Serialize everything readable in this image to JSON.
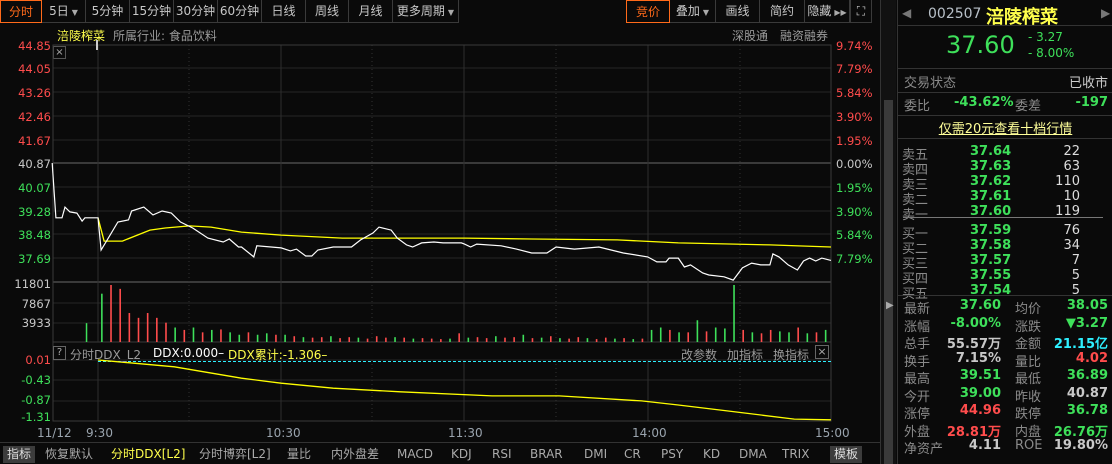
{
  "toolbar": {
    "periods": [
      {
        "label": "分时",
        "active": true
      },
      {
        "label": "5日",
        "dropdown": true
      },
      {
        "label": "5分钟"
      },
      {
        "label": "15分钟"
      },
      {
        "label": "30分钟"
      },
      {
        "label": "60分钟"
      },
      {
        "label": "日线"
      },
      {
        "label": "周线"
      },
      {
        "label": "月线"
      },
      {
        "label": "更多周期",
        "dropdown": true
      }
    ],
    "right": [
      {
        "label": "竞价",
        "active": true
      },
      {
        "label": "叠加"
      },
      {
        "label": "画线"
      },
      {
        "label": "简约"
      },
      {
        "label": "隐藏"
      }
    ]
  },
  "chart_header": {
    "name": "涪陵榨菜",
    "industry": "所属行业: 食品饮料",
    "tag1": "深股通",
    "tag2": "融资融券"
  },
  "colors": {
    "up": "#ff4c4c",
    "down": "#3ee05a",
    "price_line": "#ffffff",
    "avg_line": "#ffff00",
    "ddx_line": "#2ef0ff"
  },
  "chart_data": [
    {
      "type": "line",
      "title": "分时",
      "prev_close": 40.87,
      "y_ticks": [
        "44.85",
        "44.05",
        "43.26",
        "42.46",
        "41.67",
        "40.87",
        "40.07",
        "39.28",
        "38.48",
        "37.69"
      ],
      "pct_ticks": [
        "9.74%",
        "7.79%",
        "5.84%",
        "3.90%",
        "1.95%",
        "0.00%",
        "1.95%",
        "3.90%",
        "5.84%",
        "7.79%"
      ],
      "x_ticks": [
        "11/12",
        "9:30",
        "10:30",
        "11:30",
        "14:00",
        "15:00"
      ],
      "price_series": {
        "name": "价格",
        "minutes": [
          -15,
          -14.4,
          -13.8,
          -11.8,
          -10.8,
          -9.2,
          -6.9,
          -5.2,
          -4.3,
          0,
          1,
          3,
          6.5,
          10,
          11,
          15,
          18,
          21,
          24,
          27,
          31,
          36,
          41,
          43,
          46,
          47,
          51,
          52,
          60,
          63,
          65,
          68,
          70,
          72,
          77,
          83,
          86,
          90,
          92,
          96,
          98,
          101,
          103,
          106,
          110,
          113,
          119,
          120,
          122,
          124,
          132,
          137,
          142,
          147,
          150,
          156,
          164,
          172,
          180,
          183,
          186,
          187,
          190,
          192,
          194,
          198,
          200,
          205,
          208,
          211,
          214,
          217,
          220,
          221,
          223,
          226,
          229,
          231,
          233,
          235,
          237,
          240
        ],
        "values": [
          40.87,
          39.96,
          39.03,
          39.03,
          39.39,
          39.23,
          39.19,
          38.92,
          39.03,
          39.03,
          37.95,
          38.29,
          38.89,
          38.96,
          39.26,
          39.39,
          39.13,
          39.26,
          39.19,
          38.89,
          38.69,
          38.35,
          38.22,
          38.32,
          38.05,
          38.05,
          37.72,
          38.09,
          38.02,
          37.92,
          37.98,
          37.75,
          37.75,
          37.95,
          38.05,
          38.05,
          38.29,
          38.52,
          38.72,
          38.62,
          38.35,
          38.12,
          38.05,
          38.19,
          38.22,
          38.19,
          38.19,
          38.15,
          38.05,
          38.15,
          38.09,
          37.98,
          37.85,
          37.85,
          38.05,
          37.98,
          38.05,
          37.85,
          37.72,
          37.55,
          37.55,
          37.68,
          37.68,
          37.38,
          37.45,
          37.18,
          37.11,
          37.05,
          36.94,
          37.35,
          37.51,
          37.45,
          37.45,
          37.82,
          37.72,
          37.45,
          37.28,
          37.58,
          37.68,
          37.58,
          37.68,
          37.6
        ]
      },
      "avg_series": {
        "name": "均价",
        "minutes": [
          0,
          2,
          8,
          17,
          22,
          30,
          37,
          47,
          60,
          80,
          120,
          142,
          170,
          190,
          220,
          240
        ],
        "values": [
          39.03,
          38.25,
          38.25,
          38.62,
          38.69,
          38.76,
          38.72,
          38.55,
          38.45,
          38.35,
          38.35,
          38.32,
          38.29,
          38.19,
          38.12,
          38.05
        ]
      }
    },
    {
      "type": "bar",
      "title": "成交量",
      "y_ticks": [
        "11801",
        "7867",
        "3933"
      ],
      "ylim": [
        0,
        11801
      ],
      "auction_volume": -3900,
      "interval_minutes": 3,
      "values": [
        -10000,
        11800,
        11000,
        6000,
        5000,
        6000,
        5000,
        4000,
        -3000,
        2500,
        -3000,
        2000,
        -2500,
        2600,
        -2000,
        -1500,
        2000,
        -1500,
        -1800,
        1500,
        -1500,
        1200,
        -1000,
        900,
        1000,
        -1200,
        800,
        1000,
        -900,
        700,
        1200,
        900,
        -1000,
        900,
        -700,
        800,
        700,
        600,
        -700,
        1800,
        -900,
        1000,
        800,
        -1200,
        900,
        1000,
        -1500,
        800,
        -900,
        1200,
        -800,
        700,
        1000,
        -800,
        600,
        900,
        -700,
        800,
        -600,
        700,
        -2500,
        -3000,
        2500,
        -2000,
        2000,
        -4500,
        2200,
        -3000,
        -2800,
        -11800,
        2500,
        -2000,
        1800,
        2500,
        -2200,
        -2000,
        3000,
        -1800,
        2000,
        -2500
      ]
    },
    {
      "type": "line",
      "title": "分时DDX_L2",
      "y_ticks": [
        "0.01",
        "-0.43",
        "-0.87",
        "-1.31"
      ],
      "ylim": [
        -1.31,
        0.01
      ],
      "ddx_cum": {
        "name": "DDX累计",
        "minutes": [
          0,
          25,
          47,
          60,
          77,
          99,
          129,
          151,
          178,
          190,
          206,
          228,
          240
        ],
        "values": [
          0.01,
          -0.14,
          -0.39,
          -0.5,
          -0.61,
          -0.69,
          -0.78,
          -0.78,
          -0.89,
          -0.98,
          -1.11,
          -1.29,
          -1.306
        ]
      },
      "ddx_value": 0.0
    }
  ],
  "indicator": {
    "help": "?",
    "name": "分时DDX_L2",
    "ddx": "DDX:0.000–",
    "ddx_cum": "DDX累计:-1.306–",
    "actions": [
      "改参数",
      "加指标",
      "换指标"
    ]
  },
  "bottom_tabs": [
    "指标",
    "恢复默认",
    "分时DDX[L2]",
    "分时博弈[L2]",
    "量比",
    "内外盘差",
    "MACD",
    "KDJ",
    "RSI",
    "BRAR",
    "DMI",
    "CR",
    "PSY",
    "KD",
    "DMA",
    "TRIX",
    "模板"
  ],
  "quote": {
    "code": "002507",
    "name": "涪陵榨菜",
    "price": "37.60",
    "change": "- 3.27",
    "change_pct": "- 8.00%",
    "status_label": "交易状态",
    "status": "已收市",
    "weibi_label": "委比",
    "weibi": "-43.62%",
    "weicha_label": "委差",
    "weicha": "-197",
    "promo": "仅需20元查看十档行情",
    "asks": [
      {
        "label": "卖五",
        "price": "37.64",
        "vol": "22"
      },
      {
        "label": "卖四",
        "price": "37.63",
        "vol": "63"
      },
      {
        "label": "卖三",
        "price": "37.62",
        "vol": "110"
      },
      {
        "label": "卖二",
        "price": "37.61",
        "vol": "10"
      },
      {
        "label": "卖一",
        "price": "37.60",
        "vol": "119"
      }
    ],
    "bids": [
      {
        "label": "买一",
        "price": "37.59",
        "vol": "76"
      },
      {
        "label": "买二",
        "price": "37.58",
        "vol": "34"
      },
      {
        "label": "买三",
        "price": "37.57",
        "vol": "7"
      },
      {
        "label": "买四",
        "price": "37.55",
        "vol": "5"
      },
      {
        "label": "买五",
        "price": "37.54",
        "vol": "5"
      }
    ],
    "stats": [
      {
        "l1": "最新",
        "v1": "37.60",
        "c1": "green",
        "l2": "均价",
        "v2": "38.05",
        "c2": "green"
      },
      {
        "l1": "涨幅",
        "v1": "-8.00%",
        "c1": "green",
        "l2": "涨跌",
        "v2": "▼3.27",
        "c2": "green"
      },
      {
        "l1": "总手",
        "v1": "55.57万",
        "c1": "white",
        "l2": "金额",
        "v2": "21.15亿",
        "c2": "cyan"
      },
      {
        "l1": "换手",
        "v1": "7.15%",
        "c1": "white",
        "l2": "量比",
        "v2": "4.02",
        "c2": "red"
      },
      {
        "l1": "最高",
        "v1": "39.51",
        "c1": "green",
        "l2": "最低",
        "v2": "36.89",
        "c2": "green"
      },
      {
        "l1": "今开",
        "v1": "39.00",
        "c1": "green",
        "l2": "昨收",
        "v2": "40.87",
        "c2": "white"
      },
      {
        "l1": "涨停",
        "v1": "44.96",
        "c1": "red",
        "l2": "跌停",
        "v2": "36.78",
        "c2": "green"
      },
      {
        "l1": "外盘",
        "v1": "28.81万",
        "c1": "red",
        "l2": "内盘",
        "v2": "26.76万",
        "c2": "green"
      },
      {
        "l1": "净资产",
        "v1": "4.11",
        "c1": "white",
        "l2": "ROE",
        "v2": "19.80%",
        "c2": "white"
      }
    ]
  }
}
